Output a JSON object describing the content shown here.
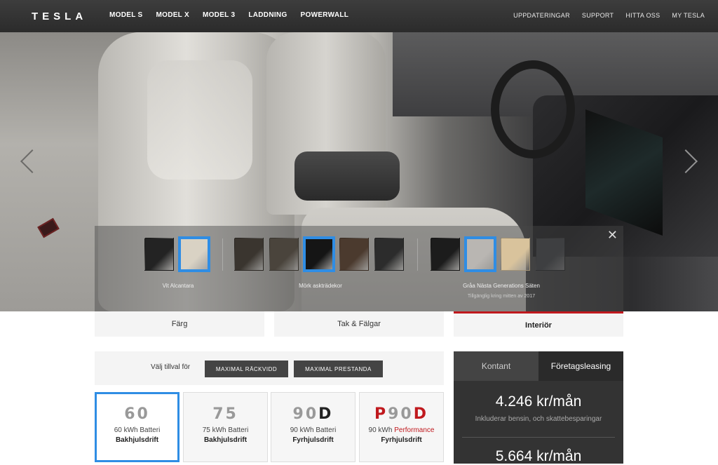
{
  "nav": {
    "logo": "TESLA",
    "left": [
      "MODEL S",
      "MODEL X",
      "MODEL 3",
      "LADDNING",
      "POWERWALL"
    ],
    "right": [
      "UPPDATERINGAR",
      "SUPPORT",
      "HITTA OSS",
      "MY TESLA"
    ]
  },
  "swatches": {
    "groups": [
      {
        "label": "Vit Alcantara",
        "colors": [
          "#232323",
          "#d9d2c4"
        ],
        "selected_index": 1
      },
      {
        "label": "Mörk askträdekor",
        "colors": [
          "#3a352f",
          "#4a443c",
          "#151515",
          "#4b3a2e",
          "#2c2c2c"
        ],
        "selected_index": 2
      },
      {
        "label": "Gråa Nästa Generations Säten",
        "sublabel": "Tillgänglig kring mitten av 2017",
        "colors": [
          "#1c1c1c",
          "#b9b6b2",
          "#d9c39c",
          "#3e3f41"
        ],
        "selected_index": 1
      }
    ],
    "close_icon": "close-icon"
  },
  "tabs": [
    {
      "label": "Färg",
      "active": false
    },
    {
      "label": "Tak & Fälgar",
      "active": false
    },
    {
      "label": "Interiör",
      "active": true
    }
  ],
  "options": {
    "label": "Välj tillval för",
    "buttons": [
      "MAXIMAL RÄCKVIDD",
      "MAXIMAL PRESTANDA"
    ]
  },
  "batteries": [
    {
      "badge": "60",
      "line1": "60 kWh Batteri",
      "line2": "Bakhjulsdrift",
      "selected": true
    },
    {
      "badge": "75",
      "line1": "75 kWh Batteri",
      "line2": "Bakhjulsdrift",
      "selected": false
    },
    {
      "badge_num": "90",
      "badge_suffix": "D",
      "line1": "90 kWh Batteri",
      "line2": "Fyrhjulsdrift",
      "selected": false
    },
    {
      "badge_prefix": "P",
      "badge_num": "90",
      "badge_suffix": "D",
      "line1_a": "90 kWh ",
      "line1_b": "Performance",
      "line2": "Fyrhjulsdrift",
      "selected": false
    }
  ],
  "price": {
    "tabs": [
      "Kontant",
      "Företagsleasing"
    ],
    "active_tab": 1,
    "main": "4.246 kr/mån",
    "sub": "Inkluderar bensin, och skattebesparingar",
    "main2": "5.664 kr/mån"
  }
}
